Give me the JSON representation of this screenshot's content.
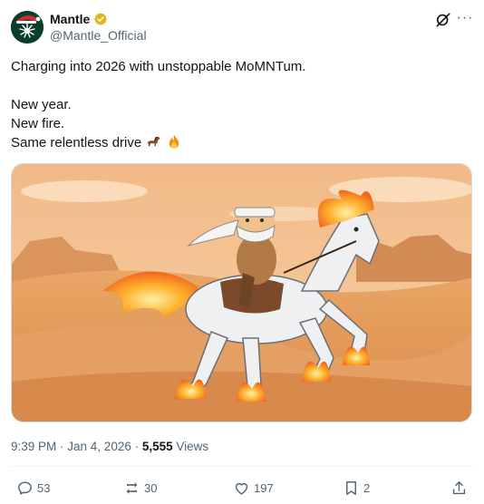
{
  "author": {
    "name": "Mantle",
    "handle": "@Mantle_Official",
    "avatar_icon": "mantle-logo-santa-hat",
    "verified_color": "#e2b719"
  },
  "header_actions": {
    "grok_icon": "grok-icon",
    "more_icon": "more-icon",
    "more_label": "···"
  },
  "tweet": {
    "lines": [
      "Charging into 2026 with unstoppable MoMNTum.",
      "",
      "New year.",
      "New fire.",
      "Same relentless drive"
    ],
    "trailing_emojis": [
      "horse-emoji",
      "fire-emoji"
    ]
  },
  "media": {
    "description_icon": "cat-riding-flaming-horse-illustration"
  },
  "meta": {
    "time": "9:39 PM",
    "separator": " · ",
    "date": "Jan 4, 2026",
    "views_count": "5,555",
    "views_label": " Views"
  },
  "actions": {
    "replies": "53",
    "reposts": "30",
    "likes": "197",
    "bookmarks": "2"
  },
  "colors": {
    "text": "#0f1419",
    "secondary": "#536471",
    "border": "#cfd9de"
  }
}
